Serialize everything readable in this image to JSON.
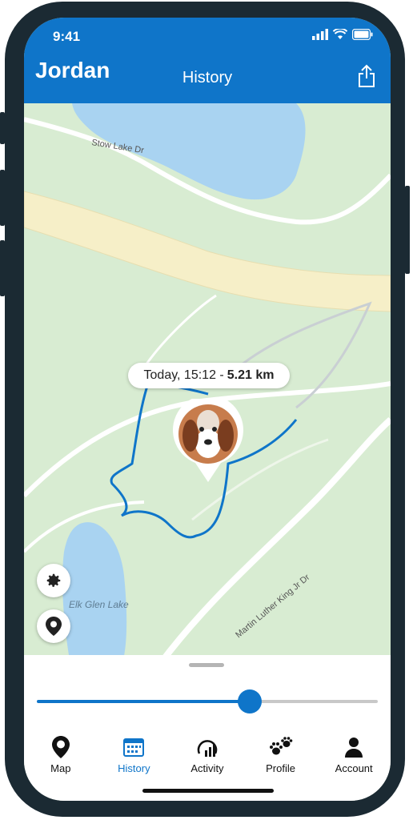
{
  "status": {
    "time": "9:41"
  },
  "header": {
    "name": "Jordan",
    "title": "History"
  },
  "map": {
    "labels": {
      "stow_lake_dr": "Stow Lake Dr",
      "mlk_dr": "Martin Luther King Jr Dr",
      "elk_glen_lake": "Elk Glen Lake"
    },
    "pill": {
      "time": "Today, 15:12 -",
      "distance": "5.21 km"
    }
  },
  "slider": {
    "value": 0.63
  },
  "tabs": [
    {
      "label": "Map",
      "icon": "map-pin-icon"
    },
    {
      "label": "History",
      "icon": "calendar-icon",
      "active": true
    },
    {
      "label": "Activity",
      "icon": "activity-icon"
    },
    {
      "label": "Profile",
      "icon": "paw-icon"
    },
    {
      "label": "Account",
      "icon": "person-icon"
    }
  ],
  "colors": {
    "accent": "#0f75c9",
    "map_bg": "#d8ecd2",
    "water": "#a9d3f1",
    "road": "#f6efc8"
  }
}
